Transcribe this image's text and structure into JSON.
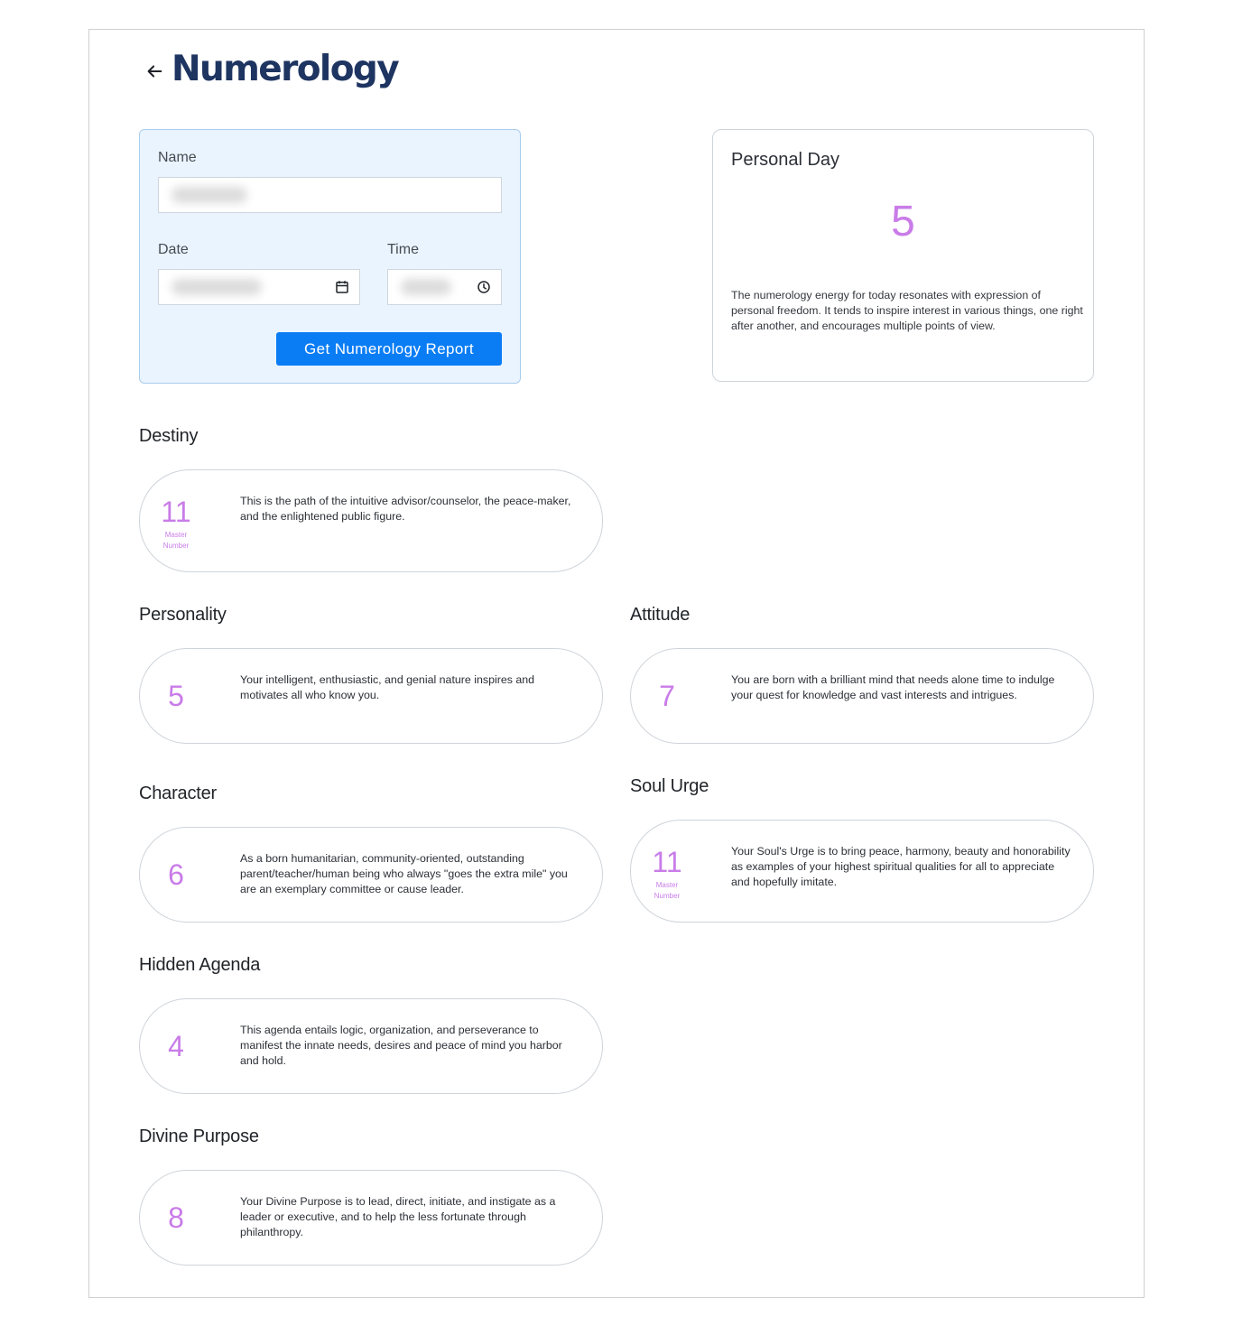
{
  "header": {
    "title": "Numerology"
  },
  "form": {
    "name_label": "Name",
    "date_label": "Date",
    "time_label": "Time",
    "submit_label": "Get Numerology Report"
  },
  "personal_day": {
    "title": "Personal Day",
    "number": "5",
    "description": "The numerology energy for today resonates with expression of personal freedom. It tends to inspire interest in various things, one right after another, and encourages multiple points of view."
  },
  "sections": {
    "destiny": {
      "title": "Destiny",
      "number": "11",
      "sub_line1": "Master",
      "sub_line2": "Number",
      "description": "This is the path of the intuitive advisor/counselor, the peace-maker, and the enlightened public figure."
    },
    "personality": {
      "title": "Personality",
      "number": "5",
      "description": "Your intelligent, enthusiastic, and genial nature inspires and motivates all who know you."
    },
    "attitude": {
      "title": "Attitude",
      "number": "7",
      "description": "You are born with a brilliant mind that needs alone time to indulge your quest for knowledge and vast interests and intrigues."
    },
    "character": {
      "title": "Character",
      "number": "6",
      "description": "As a born humanitarian, community-oriented, outstanding parent/teacher/human being who always \"goes the extra mile\" you are an exemplary committee or cause leader."
    },
    "soul_urge": {
      "title": "Soul Urge",
      "number": "11",
      "sub_line1": "Master",
      "sub_line2": "Number",
      "description": "Your Soul's Urge is to bring peace, harmony, beauty and honorability as examples of your highest spiritual qualities for all to appreciate and hopefully imitate."
    },
    "hidden_agenda": {
      "title": "Hidden Agenda",
      "number": "4",
      "description": "This agenda entails logic, organization, and perseverance to manifest the innate needs, desires and peace of mind you harbor and hold."
    },
    "divine_purpose": {
      "title": "Divine Purpose",
      "number": "8",
      "description": "Your Divine Purpose is to lead, direct, initiate, and instigate as a leader or executive, and to help the less fortunate through philanthropy."
    }
  },
  "colors": {
    "title": "#1e3461",
    "accent_number": "#c97ce8",
    "button": "#0a7df5",
    "form_background": "#eaf4fe"
  },
  "icons": [
    "back-arrow-icon",
    "calendar-icon",
    "clock-icon"
  ]
}
